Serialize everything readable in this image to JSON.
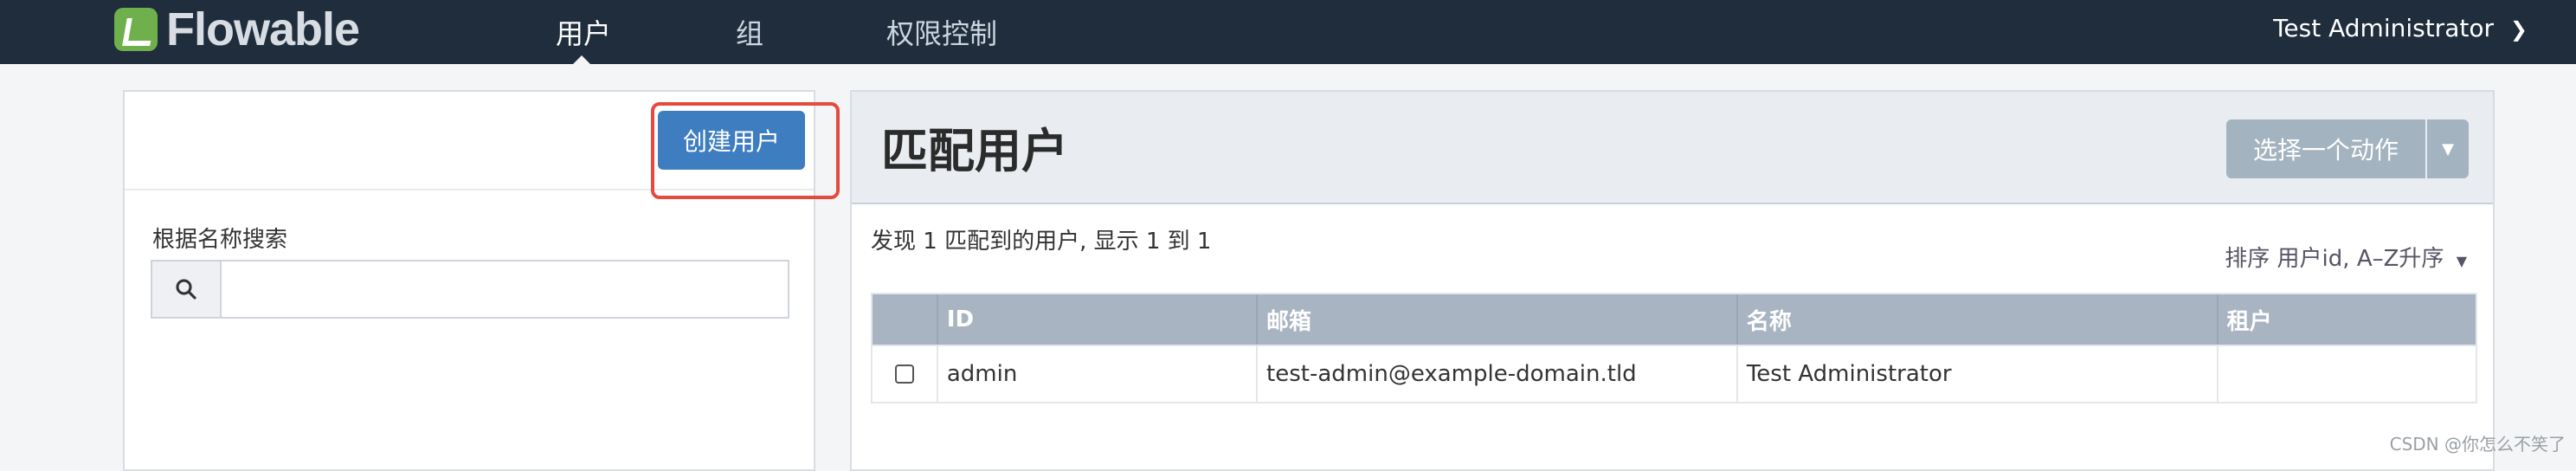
{
  "brand": {
    "logo_text_main": "Flowable",
    "accent_color": "#6fb04c"
  },
  "nav": {
    "items": [
      {
        "label": "用户",
        "active": true
      },
      {
        "label": "组",
        "active": false
      },
      {
        "label": "权限控制",
        "active": false
      }
    ],
    "user_menu": "Test Administrator",
    "bg_color": "#1f2d3d"
  },
  "left_panel": {
    "create_user_label": "创建用户",
    "search_label": "根据名称搜索",
    "search_value": "",
    "search_placeholder": ""
  },
  "right_panel": {
    "title": "匹配用户",
    "action_button": "选择一个动作",
    "found_text": "发现 1 匹配到的用户, 显示 1 到 1",
    "sort_text": "排序 用户id, A–Z升序",
    "columns": [
      "ID",
      "邮箱",
      "名称",
      "租户"
    ],
    "rows": [
      {
        "id": "admin",
        "email": "test-admin@example-domain.tld",
        "name": "Test Administrator",
        "tenant": ""
      }
    ]
  },
  "watermark": "CSDN @你怎么不笑了",
  "icons": {
    "search": "magnifier",
    "dropdown": "caret-down",
    "user_menu": "chevron-down"
  }
}
